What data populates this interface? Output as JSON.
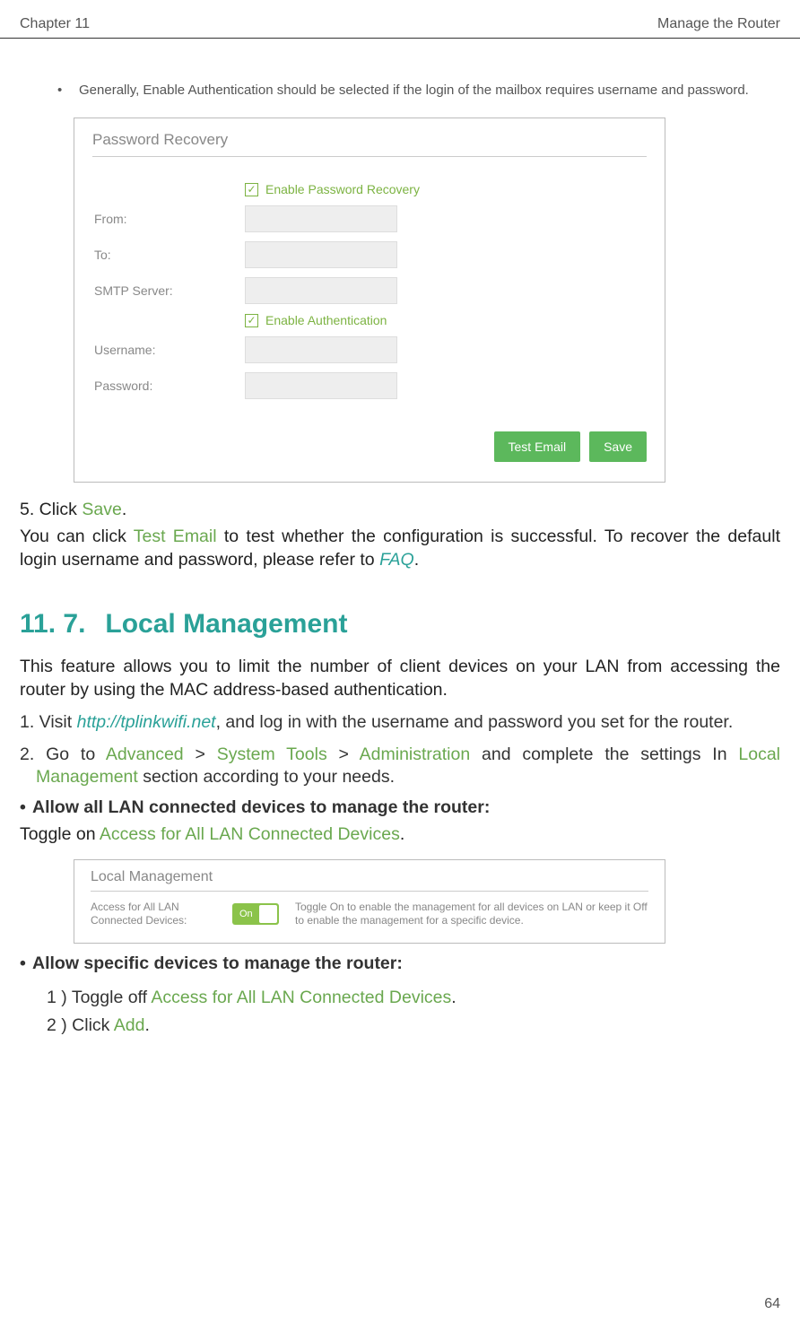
{
  "header": {
    "left": "Chapter 11",
    "right": "Manage the Router"
  },
  "bullet_note": "Generally, Enable Authentication should be selected if the login of the mailbox requires username and password.",
  "fig1": {
    "title": "Password Recovery",
    "chk1": "Enable Password Recovery",
    "rows": {
      "from": "From:",
      "to": "To:",
      "smtp": "SMTP Server:"
    },
    "chk2": "Enable Authentication",
    "rows2": {
      "user": "Username:",
      "pass": "Password:"
    },
    "btn_test": "Test Email",
    "btn_save": "Save"
  },
  "step5_a": "5. Click ",
  "step5_link": "Save",
  "step5_b": ".",
  "para2_a": "You can click ",
  "para2_link1": "Test Email",
  "para2_b": " to test whether the configuration is successful. To recover the default login username and password, please refer to ",
  "para2_link2": "FAQ",
  "para2_c": ".",
  "section": {
    "num": "11. 7.",
    "title": "Local Management"
  },
  "sec_intro": "This feature allows you to limit the number of client devices on your LAN from accessing the router by using the MAC address-based authentication.",
  "s1_a": "1. Visit ",
  "s1_link": "http://tplinkwifi.net",
  "s1_b": ", and log in with the username and password you set for the router.",
  "s2_a": "2. Go to ",
  "s2_l1": "Advanced",
  "s2_gt1": " > ",
  "s2_l2": "System Tools",
  "s2_gt2": " > ",
  "s2_l3": "Administration",
  "s2_b": " and complete the settings In ",
  "s2_l4": "Local Management",
  "s2_c": " section according to your needs.",
  "dot1": "Allow all LAN connected devices to manage the router:",
  "toggle_line_a": "Toggle on ",
  "toggle_line_link": "Access for All LAN Connected Devices",
  "toggle_line_b": ".",
  "fig2": {
    "title": "Local Management",
    "label": "Access for All LAN Connected Devices:",
    "toggle": "On",
    "desc": "Toggle On to enable the management for all devices on LAN or keep it Off to enable the management for a specific device."
  },
  "dot2": "Allow specific devices to manage the router:",
  "sub1_a": "1 )  Toggle off ",
  "sub1_link": "Access for All LAN Connected Devices",
  "sub1_b": ".",
  "sub2_a": "2 )  Click ",
  "sub2_link": "Add",
  "sub2_b": ".",
  "page": "64"
}
